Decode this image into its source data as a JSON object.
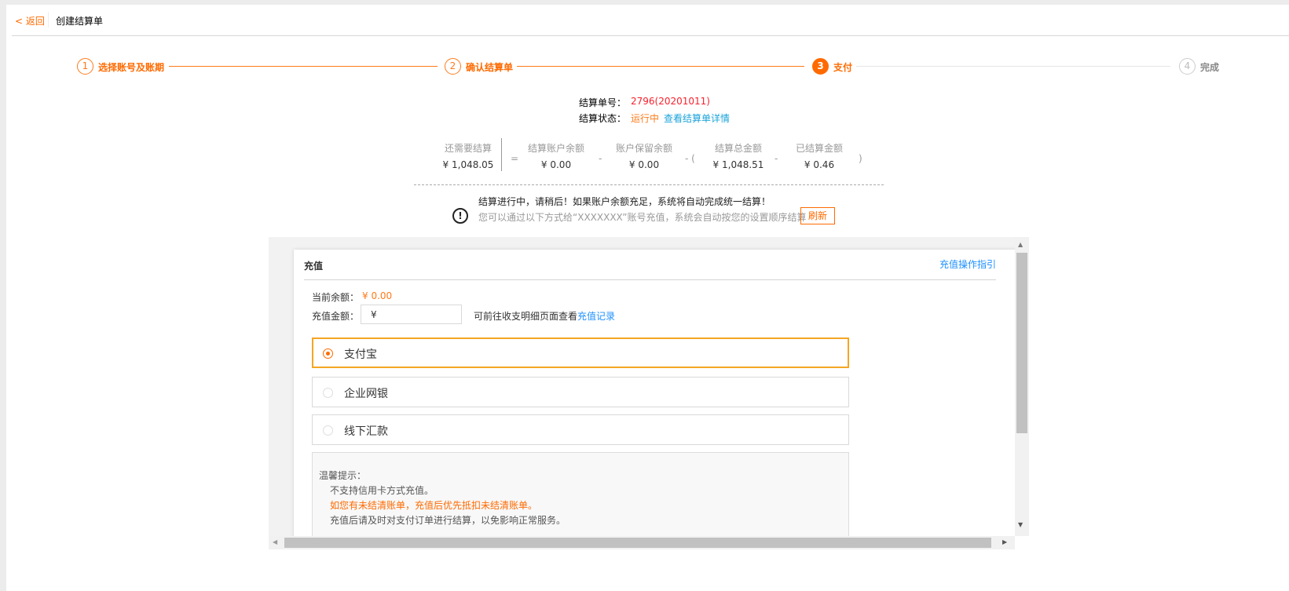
{
  "header": {
    "back_label": "< 返回",
    "title": "创建结算单"
  },
  "steps": [
    {
      "num": "1",
      "label": "选择账号及账期",
      "state": "done"
    },
    {
      "num": "2",
      "label": "确认结算单",
      "state": "done"
    },
    {
      "num": "3",
      "label": "支付",
      "state": "active"
    },
    {
      "num": "4",
      "label": "完成",
      "state": "pending"
    }
  ],
  "info": {
    "order_label": "结算单号：",
    "order_value": "2796(20201011)",
    "status_label": "结算状态：",
    "status_value": "运行中",
    "detail_link": "查看结算单详情"
  },
  "summary": {
    "remaining": {
      "label": "还需要结算",
      "value": "¥ 1,048.05"
    },
    "account_balance": {
      "label": "结算账户余额",
      "value": "¥ 0.00"
    },
    "reserved_balance": {
      "label": "账户保留余额",
      "value": "¥ 0.00"
    },
    "total_amount": {
      "label": "结算总金额",
      "value": "¥ 1,048.51"
    },
    "settled_amount": {
      "label": "已结算金额",
      "value": "¥ 0.46"
    },
    "ops": {
      "eq": "=",
      "minus": "-",
      "minus_paren": "- (",
      "close_paren": ")"
    }
  },
  "notice": {
    "line1": "结算进行中，请稍后！如果账户余额充足，系统将自动完成统一结算！",
    "line2": "您可以通过以下方式给“XXXXXXX”账号充值，系统会自动按您的设置顺序结算",
    "refresh_label": "刷新"
  },
  "recharge": {
    "title": "充值",
    "guide_link": "充值操作指引",
    "balance_label": "当前余额：",
    "balance_value": "¥ 0.00",
    "amount_label": "充值金额：",
    "amount_prefix": "¥",
    "amount_value": "",
    "hint": "可前往收支明细页面查看",
    "hint_link": "充值记录",
    "methods": [
      {
        "label": "支付宝",
        "selected": true
      },
      {
        "label": "企业网银",
        "selected": false
      },
      {
        "label": "线下汇款",
        "selected": false
      }
    ],
    "tips": {
      "title": "温馨提示：",
      "items": [
        "不支持信用卡方式充值。",
        "如您有未结清账单，充值后优先抵扣未结清账单。",
        "充值后请及时对支付订单进行结算，以免影响正常服务。"
      ]
    }
  },
  "colors": {
    "accent": "#ff6a00",
    "link": "#1e90ff",
    "red": "#f5222d",
    "green": "#3db84a"
  }
}
